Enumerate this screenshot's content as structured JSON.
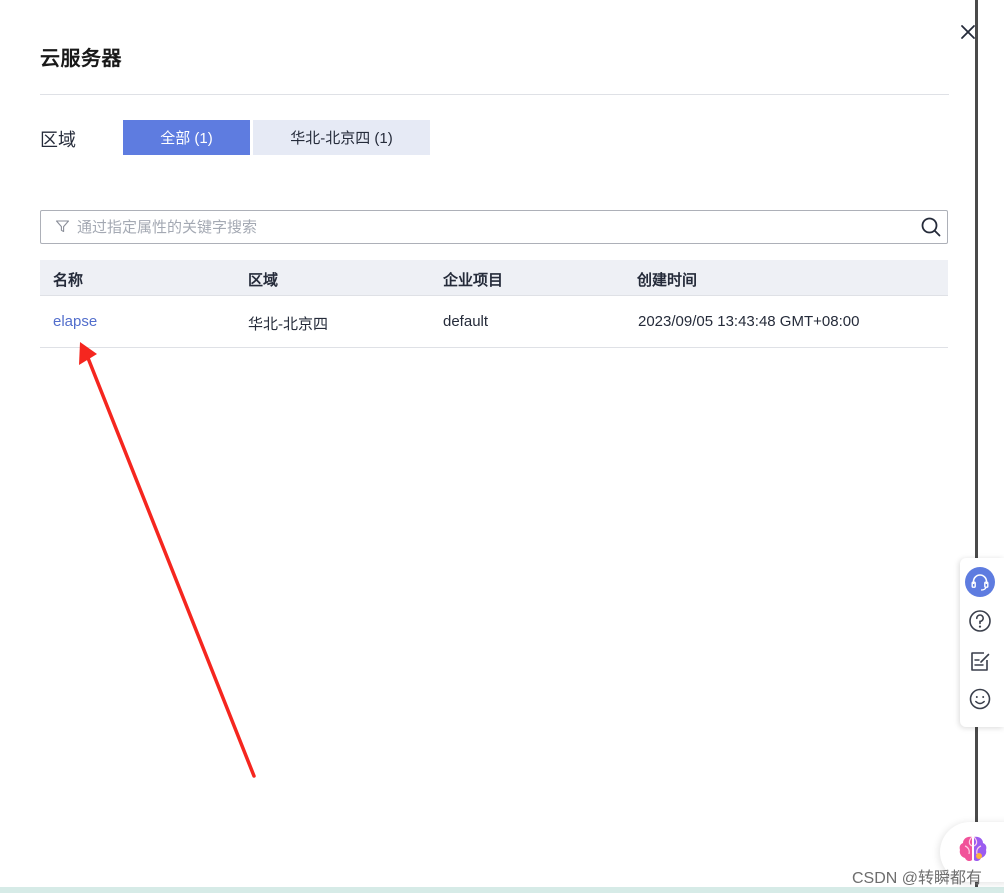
{
  "dialog": {
    "title": "云服务器"
  },
  "region_filter": {
    "label": "区域",
    "tabs": [
      {
        "label": "全部 (1)",
        "active": true
      },
      {
        "label": "华北-北京四 (1)",
        "active": false
      }
    ]
  },
  "search": {
    "placeholder": "通过指定属性的关键字搜索",
    "value": ""
  },
  "table": {
    "columns": [
      "名称",
      "区域",
      "企业项目",
      "创建时间"
    ],
    "rows": [
      {
        "name": "elapse",
        "region": "华北-北京四",
        "enterprise_project": "default",
        "created": "2023/09/05 13:43:48 GMT+08:00"
      }
    ]
  },
  "floating_toolbar": {
    "icons": [
      "headset-icon",
      "help-icon",
      "feedback-icon",
      "smile-icon"
    ]
  },
  "ai_assistant": {
    "icon": "brain-icon"
  },
  "watermark": "CSDN @转瞬都有",
  "colors": {
    "accent": "#5e7ce0",
    "link": "#526ecc",
    "tab_inactive": "#e6eaf5",
    "table_header_bg": "#eef0f5",
    "annotation_arrow": "#f5261f"
  }
}
